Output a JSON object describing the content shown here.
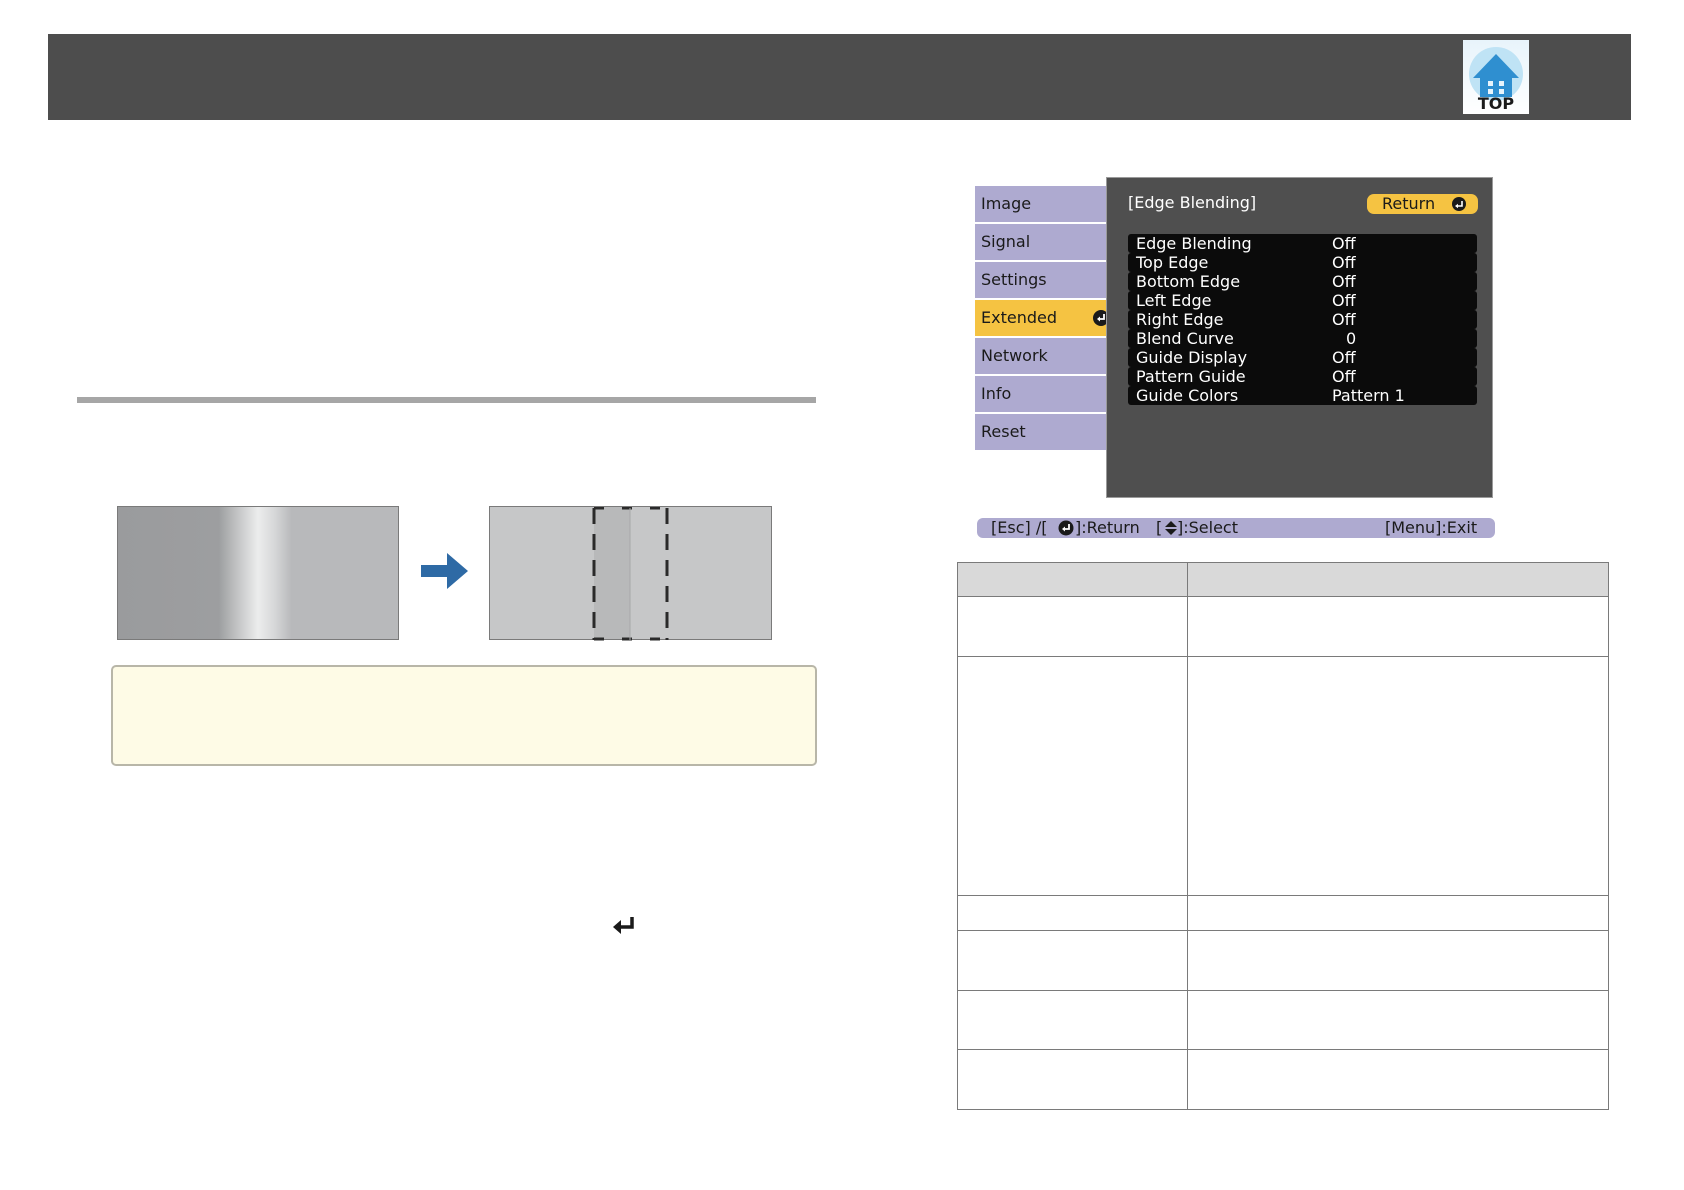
{
  "header": {
    "logo_text": "TOP",
    "logo_icon": "house-icon"
  },
  "osd_menu": {
    "tabs": [
      {
        "label": "Image",
        "active": false
      },
      {
        "label": "Signal",
        "active": false
      },
      {
        "label": "Settings",
        "active": false
      },
      {
        "label": "Extended",
        "active": true
      },
      {
        "label": "Network",
        "active": false
      },
      {
        "label": "Info",
        "active": false
      },
      {
        "label": "Reset",
        "active": false
      }
    ],
    "title": "[Edge Blending]",
    "return_label": "Return",
    "rows": [
      {
        "label": "Edge Blending",
        "value": "Off"
      },
      {
        "label": "Top Edge",
        "value": "Off"
      },
      {
        "label": "Bottom Edge",
        "value": "Off"
      },
      {
        "label": "Left Edge",
        "value": "Off"
      },
      {
        "label": "Right Edge",
        "value": "Off"
      },
      {
        "label": "Blend Curve",
        "value": "0"
      },
      {
        "label": "Guide Display",
        "value": "Off"
      },
      {
        "label": "Pattern Guide",
        "value": "Off"
      },
      {
        "label": "Guide Colors",
        "value": "Pattern 1"
      }
    ],
    "footer": {
      "esc": "[Esc] /[",
      "esc_return": "]:Return",
      "select_open": "[",
      "select": "]:Select",
      "exit": "[Menu]:Exit"
    }
  },
  "colors": {
    "header_bar": "#4d4d4d",
    "menu_tab": "#aeaad0",
    "menu_tab_active": "#f5c342",
    "osd_background": "#4f4f4f",
    "arrow": "#2e6aa5",
    "note_background": "#fefbe6"
  }
}
